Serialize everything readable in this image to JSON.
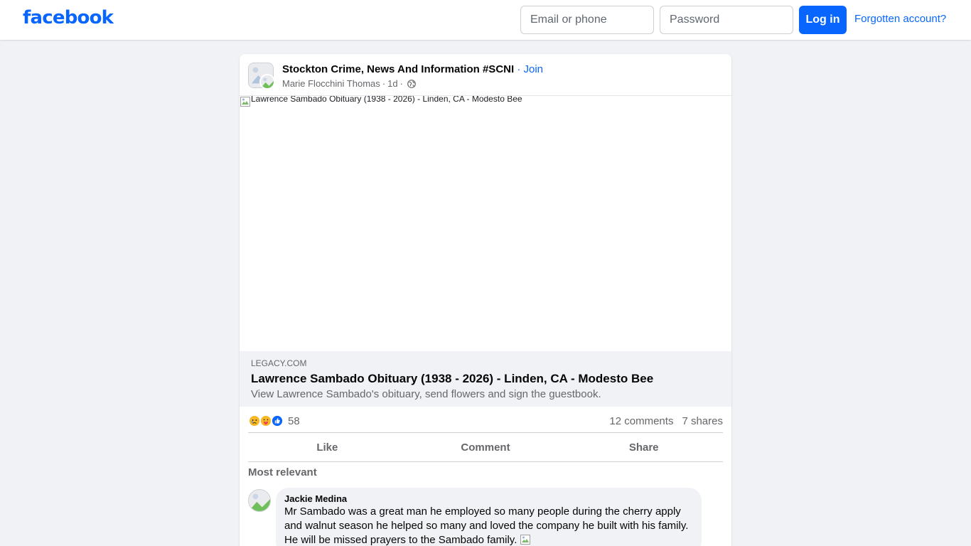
{
  "colors": {
    "brand": "#0866ff",
    "page_bg": "#f0f2f5",
    "muted_text": "#65676b"
  },
  "header": {
    "logo_text": "facebook",
    "email_placeholder": "Email or phone",
    "password_placeholder": "Password",
    "login_label": "Log in",
    "forgot_label": "Forgotten account?"
  },
  "post": {
    "group_name": "Stockton Crime, News And Information #SCNI",
    "join_label": "· Join",
    "author": "Marie Flocchini Thomas",
    "separator": "·",
    "time": "1d",
    "privacy_icon": "globe-icon",
    "image_alt": "Lawrence Sambado Obituary (1938 - 2026) - Linden, CA - Modesto Bee",
    "link": {
      "domain": "LEGACY.COM",
      "title": "Lawrence Sambado Obituary (1938 - 2026) - Linden, CA - Modesto Bee",
      "description": "View Lawrence Sambado's obituary, send flowers and sign the guestbook."
    },
    "reactions": {
      "icons": [
        "sad-reaction-icon",
        "care-reaction-icon",
        "like-reaction-icon"
      ],
      "count": "58"
    },
    "comments_count": "12 comments",
    "shares_count": "7 shares",
    "actions": {
      "like": "Like",
      "comment": "Comment",
      "share": "Share"
    },
    "sort_label": "Most relevant",
    "comments": [
      {
        "author": "Jackie Medina",
        "text": "Mr Sambado was a great man he employed so many people during the cherry apply and walnut season he helped so many and loved the company he built with his family. He will be missed prayers to the Sambado family."
      }
    ]
  }
}
